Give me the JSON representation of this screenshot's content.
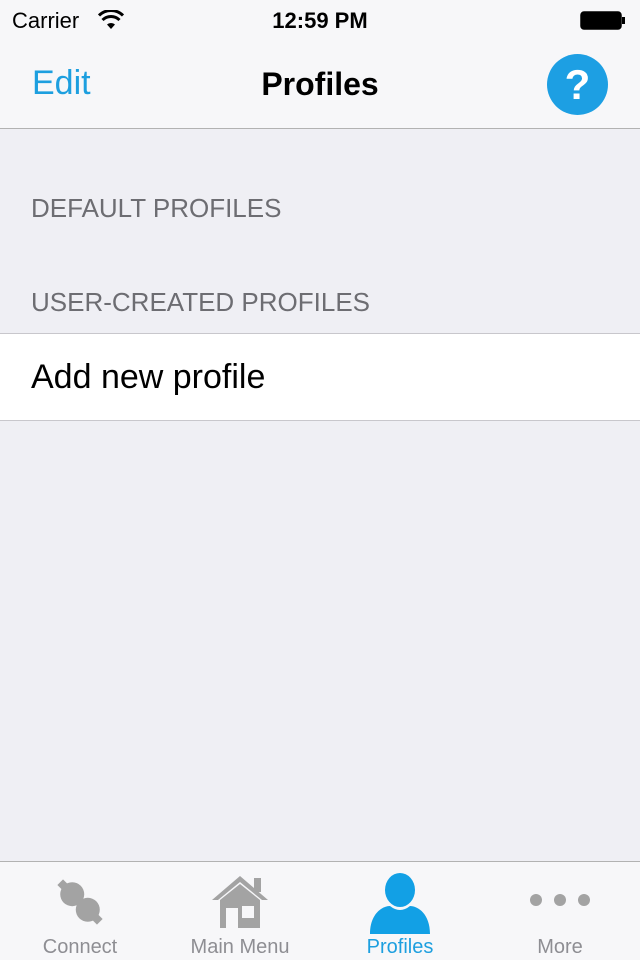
{
  "status_bar": {
    "carrier": "Carrier",
    "time": "12:59 PM",
    "wifi_icon": "wifi-icon",
    "battery_icon": "battery-icon"
  },
  "nav_bar": {
    "left_button": "Edit",
    "title": "Profiles",
    "right_button_icon": "help-icon",
    "right_button_glyph": "?"
  },
  "sections": [
    {
      "header": "DEFAULT PROFILES",
      "items": []
    },
    {
      "header": "USER-CREATED PROFILES",
      "items": [
        {
          "label": "Add new profile"
        }
      ]
    }
  ],
  "tab_bar": {
    "tabs": [
      {
        "label": "Connect",
        "icon": "connector-icon",
        "active": false
      },
      {
        "label": "Main Menu",
        "icon": "home-icon",
        "active": false
      },
      {
        "label": "Profiles",
        "icon": "person-icon",
        "active": true
      },
      {
        "label": "More",
        "icon": "more-icon",
        "active": false
      }
    ]
  },
  "colors": {
    "accent": "#1d9fdf",
    "background": "#efeff4",
    "inactive_tab": "#8e8e93",
    "section_header": "#6d6d72"
  }
}
